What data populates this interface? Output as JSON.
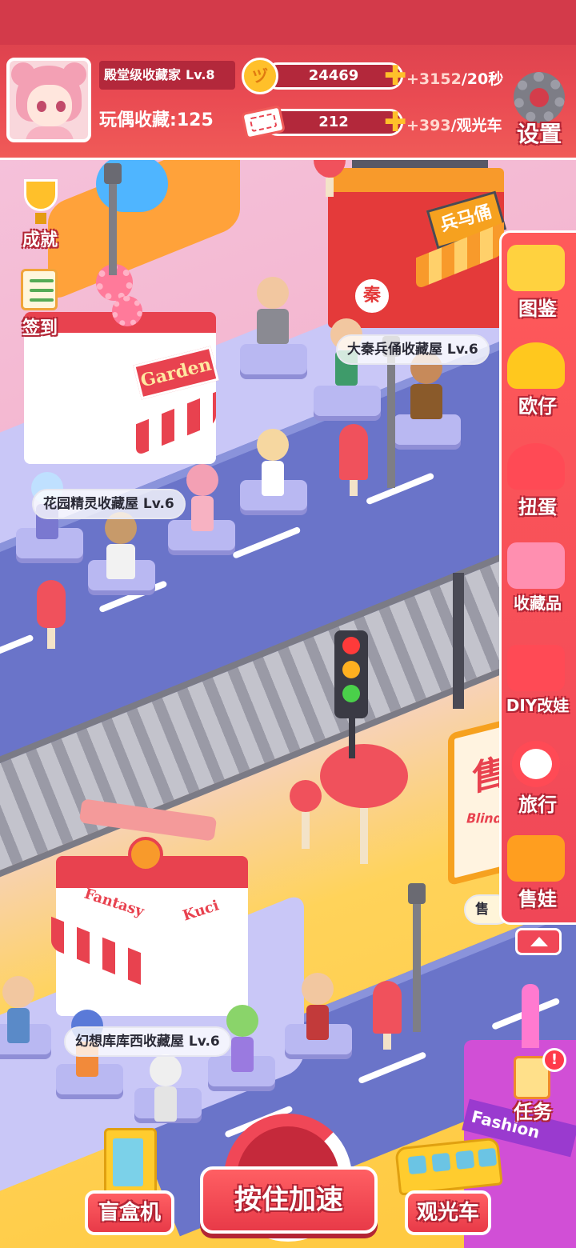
{
  "header": {
    "rank_title": "殿堂级收藏家",
    "rank_level": "Lv.8",
    "dolls_label": "玩偶收藏",
    "dolls_separator": ":",
    "dolls_count": "125",
    "coins": {
      "value": "24469",
      "rate_amount": "+3152",
      "rate_unit": "/20秒",
      "icon": "coin-icon"
    },
    "tickets": {
      "value": "212",
      "rate_amount": "+393",
      "rate_unit": "/观光车",
      "icon": "ticket-icon"
    },
    "settings_label": "设置"
  },
  "left_menu": {
    "achievements_label": "成就",
    "checkin_label": "签到"
  },
  "buildings": {
    "qin": {
      "label": "大秦兵俑收藏屋 Lv.6",
      "sign": "兵马俑",
      "seal": "秦"
    },
    "garden": {
      "label": "花园精灵收藏屋 Lv.6",
      "sign": "Garden"
    },
    "fantasy": {
      "label": "幻想库库西收藏屋 Lv.6",
      "sign_1": "Fantasy",
      "sign_2": "Kuci"
    },
    "shop": {
      "label_partial": "售",
      "sign": "售",
      "sign_en": "Blind Box"
    },
    "fashion": {
      "sign": "Fashion"
    }
  },
  "right_menu": [
    {
      "label": "图鉴",
      "icon": "folder-icon",
      "color": "#ffd23f"
    },
    {
      "label": "欧仔",
      "icon": "helmet-icon",
      "color": "#ffc81e"
    },
    {
      "label": "扭蛋",
      "icon": "capsule-icon",
      "color": "#ff4a55"
    },
    {
      "label": "收藏品",
      "icon": "box-icon",
      "color": "#ff8fb0"
    },
    {
      "label": "DIY改娃",
      "icon": "gamepad-icon",
      "color": "#ff4a55"
    },
    {
      "label": "旅行",
      "icon": "lifebuoy-icon",
      "color": "#ffffff"
    },
    {
      "label": "售娃",
      "icon": "bear-icon",
      "color": "#ff9e1f"
    }
  ],
  "task": {
    "label": "任务",
    "alert": "!"
  },
  "bottom": {
    "blindbox_machine": "盲盒机",
    "boost": "按住加速",
    "tour_bus": "观光车"
  },
  "colors": {
    "header_red": "#d43d4b",
    "accent_gold": "#ffc02a",
    "road": "#6a74c9",
    "ground_yellow": "#ffc83d"
  }
}
